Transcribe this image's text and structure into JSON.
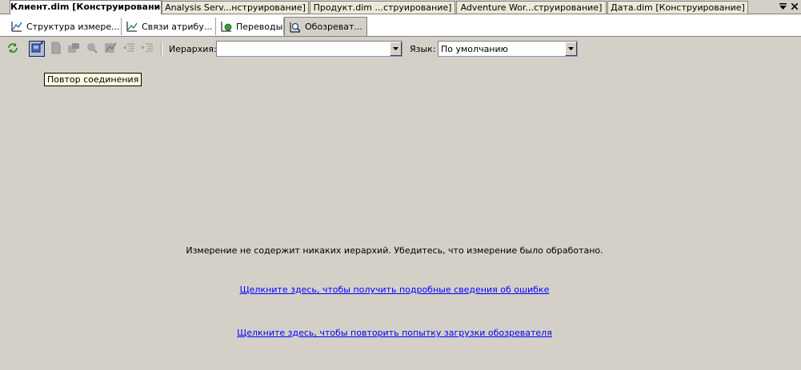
{
  "document_tabs": [
    {
      "label": "Клиент.dim [Конструирование]",
      "active": true
    },
    {
      "label": "Analysis Serv...нструирование]",
      "active": false
    },
    {
      "label": "Продукт.dim ...струирование]",
      "active": false
    },
    {
      "label": "Adventure Wor...струирование]",
      "active": false
    },
    {
      "label": "Дата.dim [Конструирование]",
      "active": false
    }
  ],
  "designer_tabs": [
    {
      "label": "Структура измере...",
      "icon": "dimension-structure-icon"
    },
    {
      "label": "Связи атрибу...",
      "icon": "attribute-relationships-icon"
    },
    {
      "label": "Переводы",
      "icon": "translations-icon"
    },
    {
      "label": "Обозреват...",
      "icon": "browser-icon",
      "active": true
    }
  ],
  "toolbar": {
    "hierarchy_label": "Иерархия:",
    "hierarchy_value": "",
    "language_label": "Язык:",
    "language_value": "По умолчанию",
    "tooltip": "Повтор соединения"
  },
  "content": {
    "message": "Измерение не содержит никаких иерархий. Убедитесь, что измерение было обработано.",
    "details_link": "Щелкните здесь, чтобы получить подробные сведения об ошибке",
    "retry_link": "Щелкните здесь, чтобы повторить попытку загрузки обозревателя"
  },
  "colors": {
    "background": "#d4d0c8",
    "link": "#0000ff",
    "tooltip_bg": "#ffffe1"
  }
}
